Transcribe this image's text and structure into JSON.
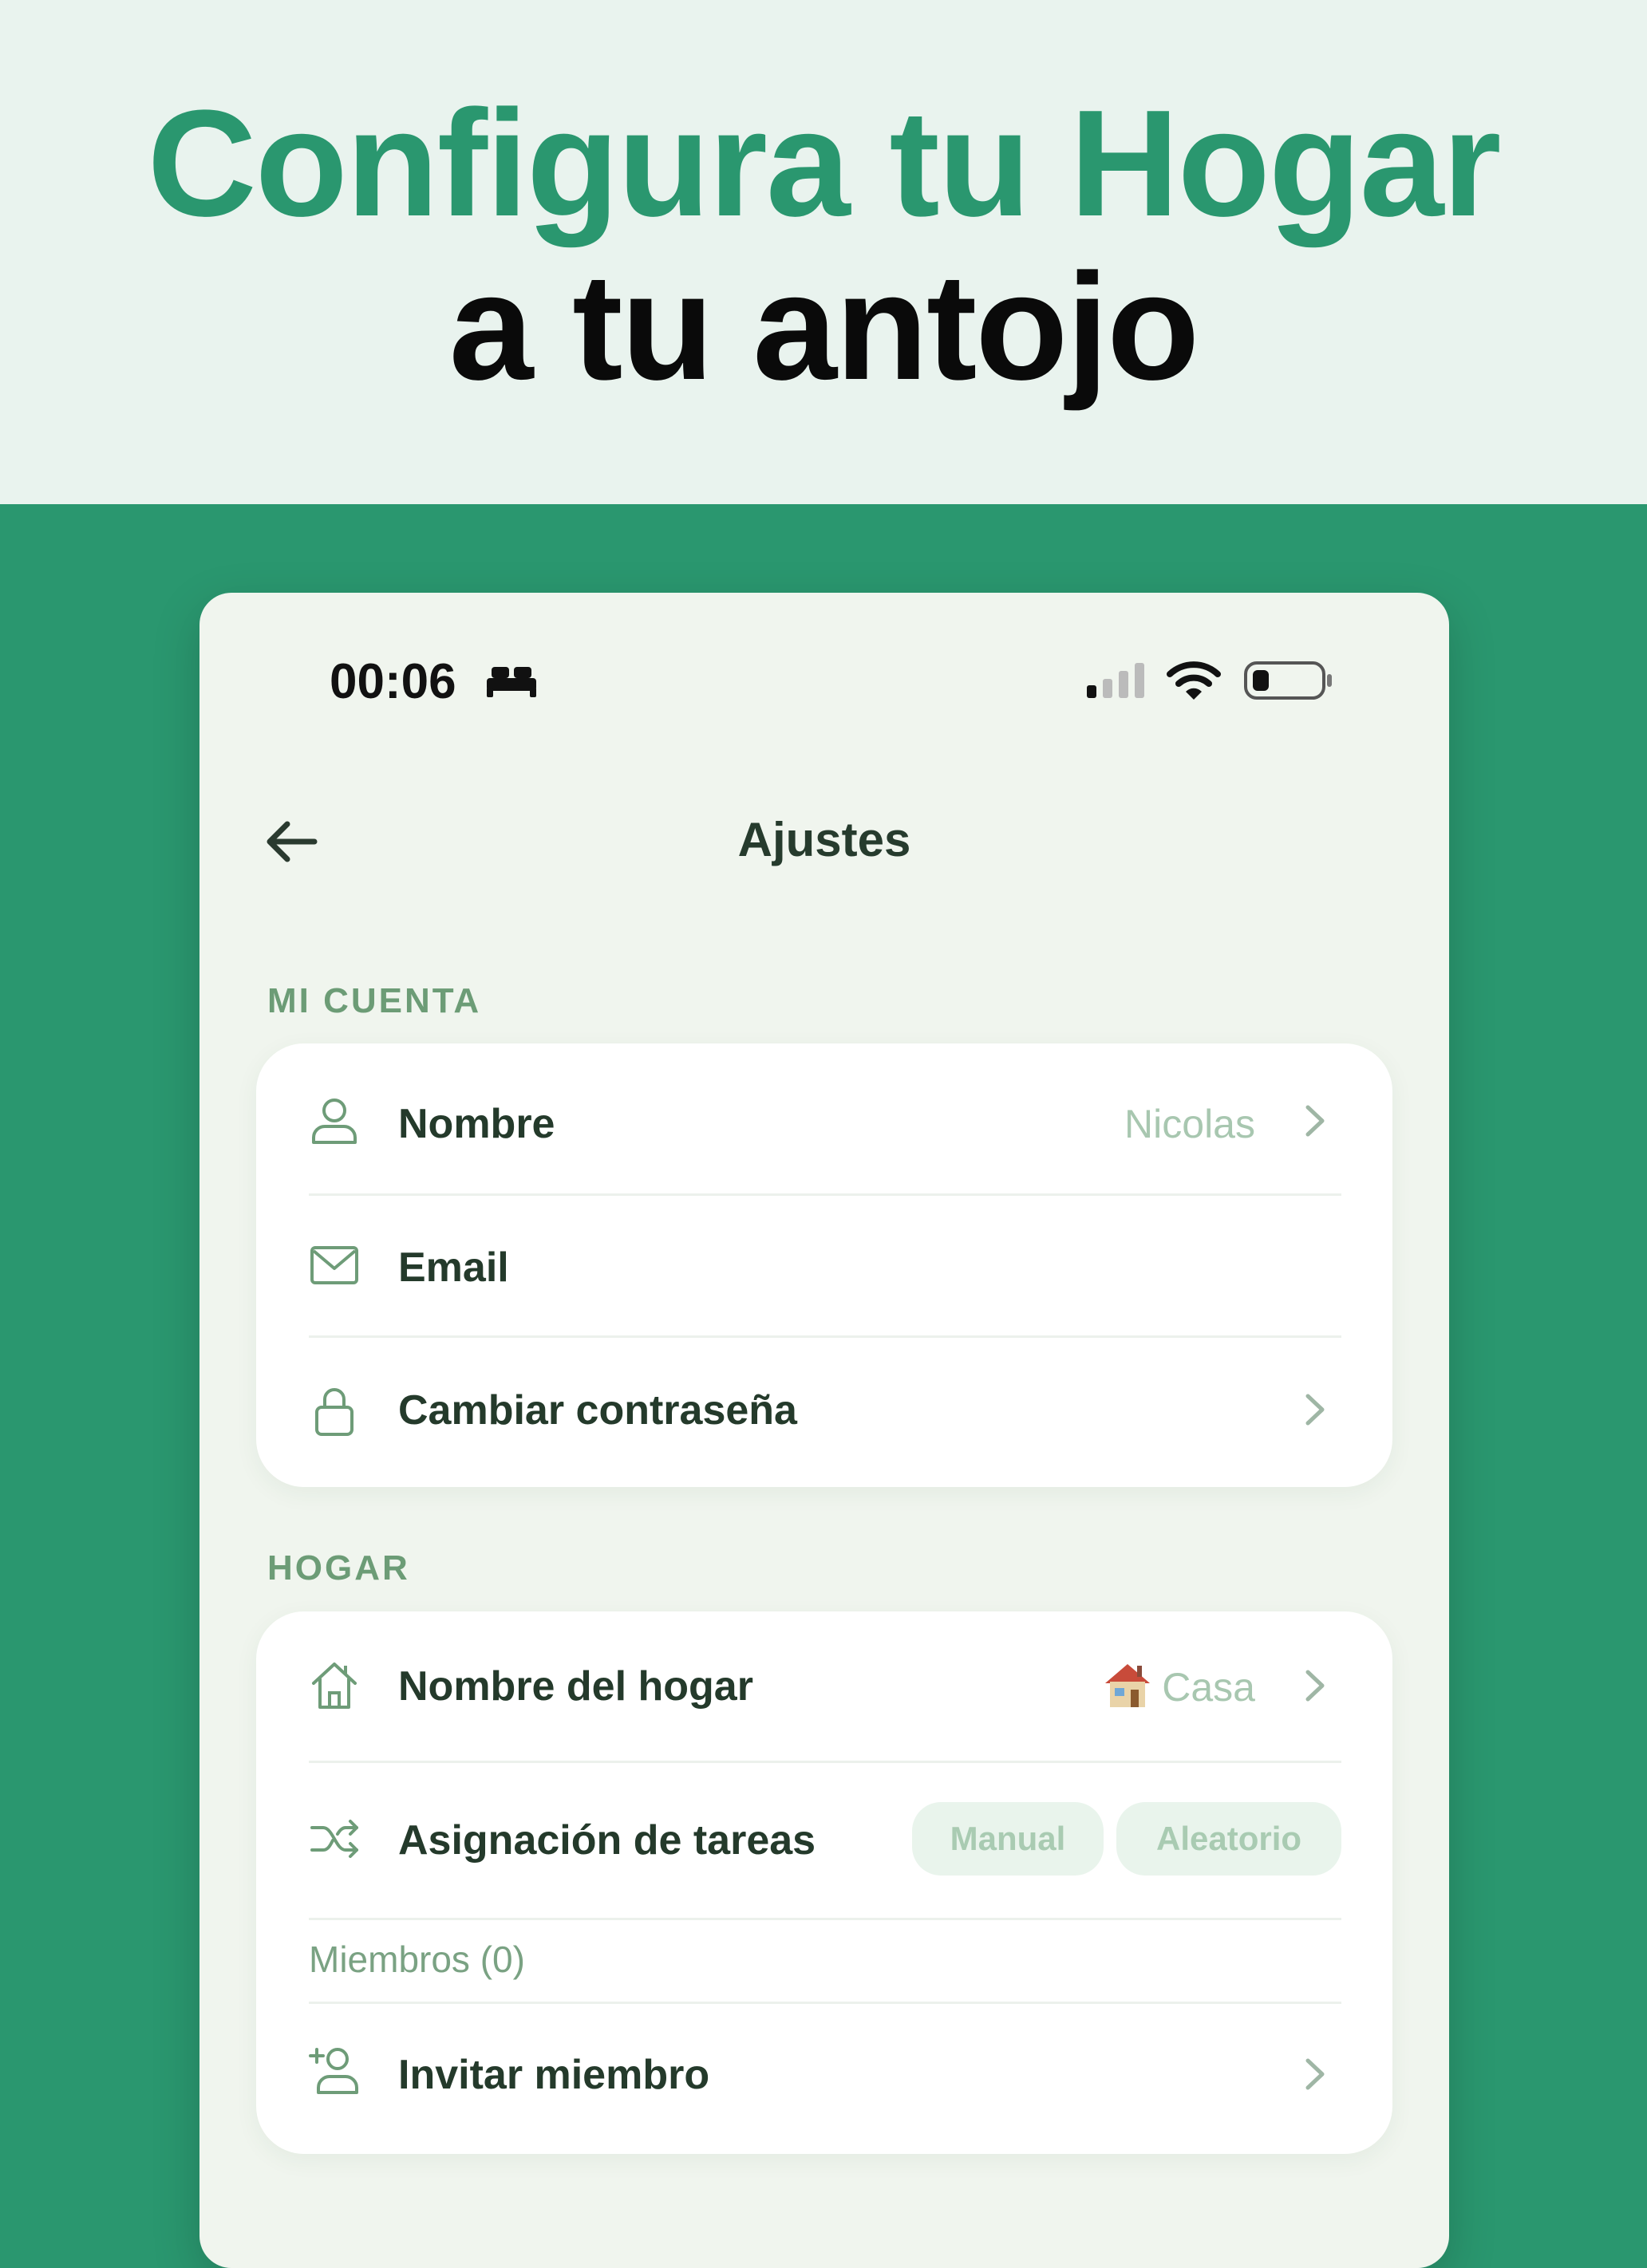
{
  "hero": {
    "title_line1": "Configura tu Hogar",
    "title_line2": "a tu antojo"
  },
  "colors": {
    "brand_green": "#2a976f",
    "hero_bg": "#e9f3ee",
    "phone_bg": "#f0f5ee",
    "section_label": "#6c9c76",
    "muted_value": "#a8c7b0"
  },
  "status_bar": {
    "time": "00:06",
    "icons": [
      "bed-icon",
      "signal-icon",
      "wifi-icon",
      "battery-icon"
    ]
  },
  "header": {
    "title": "Ajustes",
    "back_icon": "arrow-left-icon"
  },
  "account": {
    "section_label": "MI CUENTA",
    "rows": [
      {
        "icon": "user-icon",
        "label": "Nombre",
        "value": "Nicolas",
        "chevron": true
      },
      {
        "icon": "mail-icon",
        "label": "Email",
        "value": "",
        "chevron": false
      },
      {
        "icon": "lock-icon",
        "label": "Cambiar contraseña",
        "value": "",
        "chevron": true
      }
    ]
  },
  "home": {
    "section_label": "HOGAR",
    "name_row": {
      "icon": "home-icon",
      "label": "Nombre del hogar",
      "value": "Casa",
      "value_emoji": "house-emoji"
    },
    "assignment_row": {
      "icon": "shuffle-icon",
      "label": "Asignación de tareas",
      "options": [
        "Manual",
        "Aleatorio"
      ]
    },
    "members_label": "Miembros (0)",
    "invite_row": {
      "icon": "user-plus-icon",
      "label": "Invitar miembro"
    }
  }
}
